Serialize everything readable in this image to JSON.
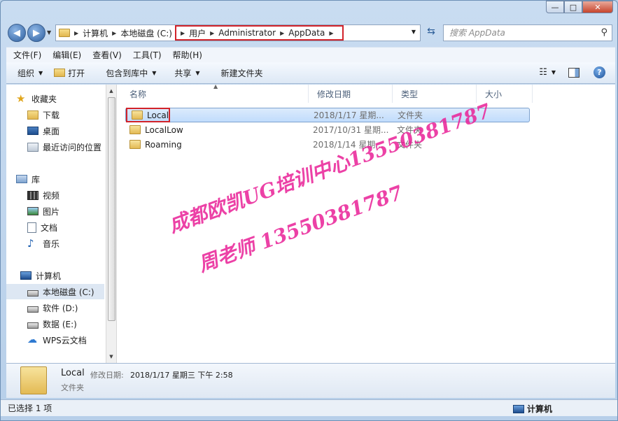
{
  "window": {
    "caption": {
      "minimize": "—",
      "maximize": "□",
      "close": "✕"
    }
  },
  "address": {
    "crumbs": [
      "计算机",
      "本地磁盘 (C:)"
    ],
    "highlighted_crumbs": [
      "用户",
      "Administrator",
      "AppData"
    ],
    "search_placeholder": "搜索 AppData"
  },
  "menubar": {
    "items": [
      "文件(F)",
      "编辑(E)",
      "查看(V)",
      "工具(T)",
      "帮助(H)"
    ]
  },
  "toolbar": {
    "organize": "组织",
    "open": "打开",
    "include_library": "包含到库中",
    "share": "共享",
    "new_folder": "新建文件夹"
  },
  "navpane": {
    "favorites_header": "收藏夹",
    "favorites": [
      "下载",
      "桌面",
      "最近访问的位置"
    ],
    "libraries_header": "库",
    "libraries": [
      "视频",
      "图片",
      "文档",
      "音乐"
    ],
    "computer_header": "计算机",
    "drives": [
      "本地磁盘 (C:)",
      "软件 (D:)",
      "数据 (E:)",
      "WPS云文档"
    ]
  },
  "filelist": {
    "columns": [
      "名称",
      "修改日期",
      "类型",
      "大小"
    ],
    "rows": [
      {
        "name": "Local",
        "date": "2018/1/17 星期...",
        "type": "文件夹"
      },
      {
        "name": "LocalLow",
        "date": "2017/10/31 星期...",
        "type": "文件夹"
      },
      {
        "name": "Roaming",
        "date": "2018/1/14 星期...",
        "type": "文件夹"
      }
    ]
  },
  "details": {
    "name": "Local",
    "modified_label": "修改日期:",
    "modified_value": "2018/1/17 星期三 下午 2:58",
    "type": "文件夹"
  },
  "status": {
    "selection": "已选择 1 项",
    "computer": "计算机"
  },
  "watermark": {
    "line1": "成都欧凯UG培训中心13550381787",
    "line2": "周老师 13550381787"
  },
  "colors": {
    "highlight_box": "#d2232a",
    "watermark": "#e92096",
    "selection": "#c1dcfc"
  }
}
